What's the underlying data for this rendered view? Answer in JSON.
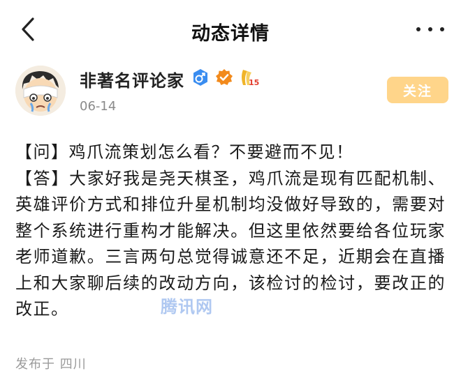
{
  "nav": {
    "title": "动态详情",
    "back_icon": "chevron-left-icon",
    "more_icon": "more-horizontal-icon"
  },
  "author": {
    "name": "非著名评论家",
    "date": "06-14",
    "follow_label": "关注",
    "badges": [
      "male-gender-icon",
      "verified-badge-icon",
      "level-badge-icon"
    ],
    "level": "15"
  },
  "post": {
    "paragraphs": [
      "【问】鸡爪流策划怎么看？不要避而不见！",
      "【答】大家好我是尧天棋圣，鸡爪流是现有匹配机制、英雄评价方式和排位升星机制均没做好导致的，需要对整个系统进行重构才能解决。但这里依然要给各位玩家老师道歉。三言两句总觉得诚意还不足，近期会在直播上和大家聊后续的改动方向，该检讨的检讨，要改正的改正。"
    ]
  },
  "footer": {
    "location": "发布于 四川"
  },
  "watermark": {
    "text": "腾讯网"
  },
  "colors": {
    "follow_bg": "#ffd58a",
    "gender_blue": "#3a8df0",
    "verified_orange": "#f28a1c",
    "level_gold": "#f0b429",
    "level_red": "#e23c2c"
  }
}
